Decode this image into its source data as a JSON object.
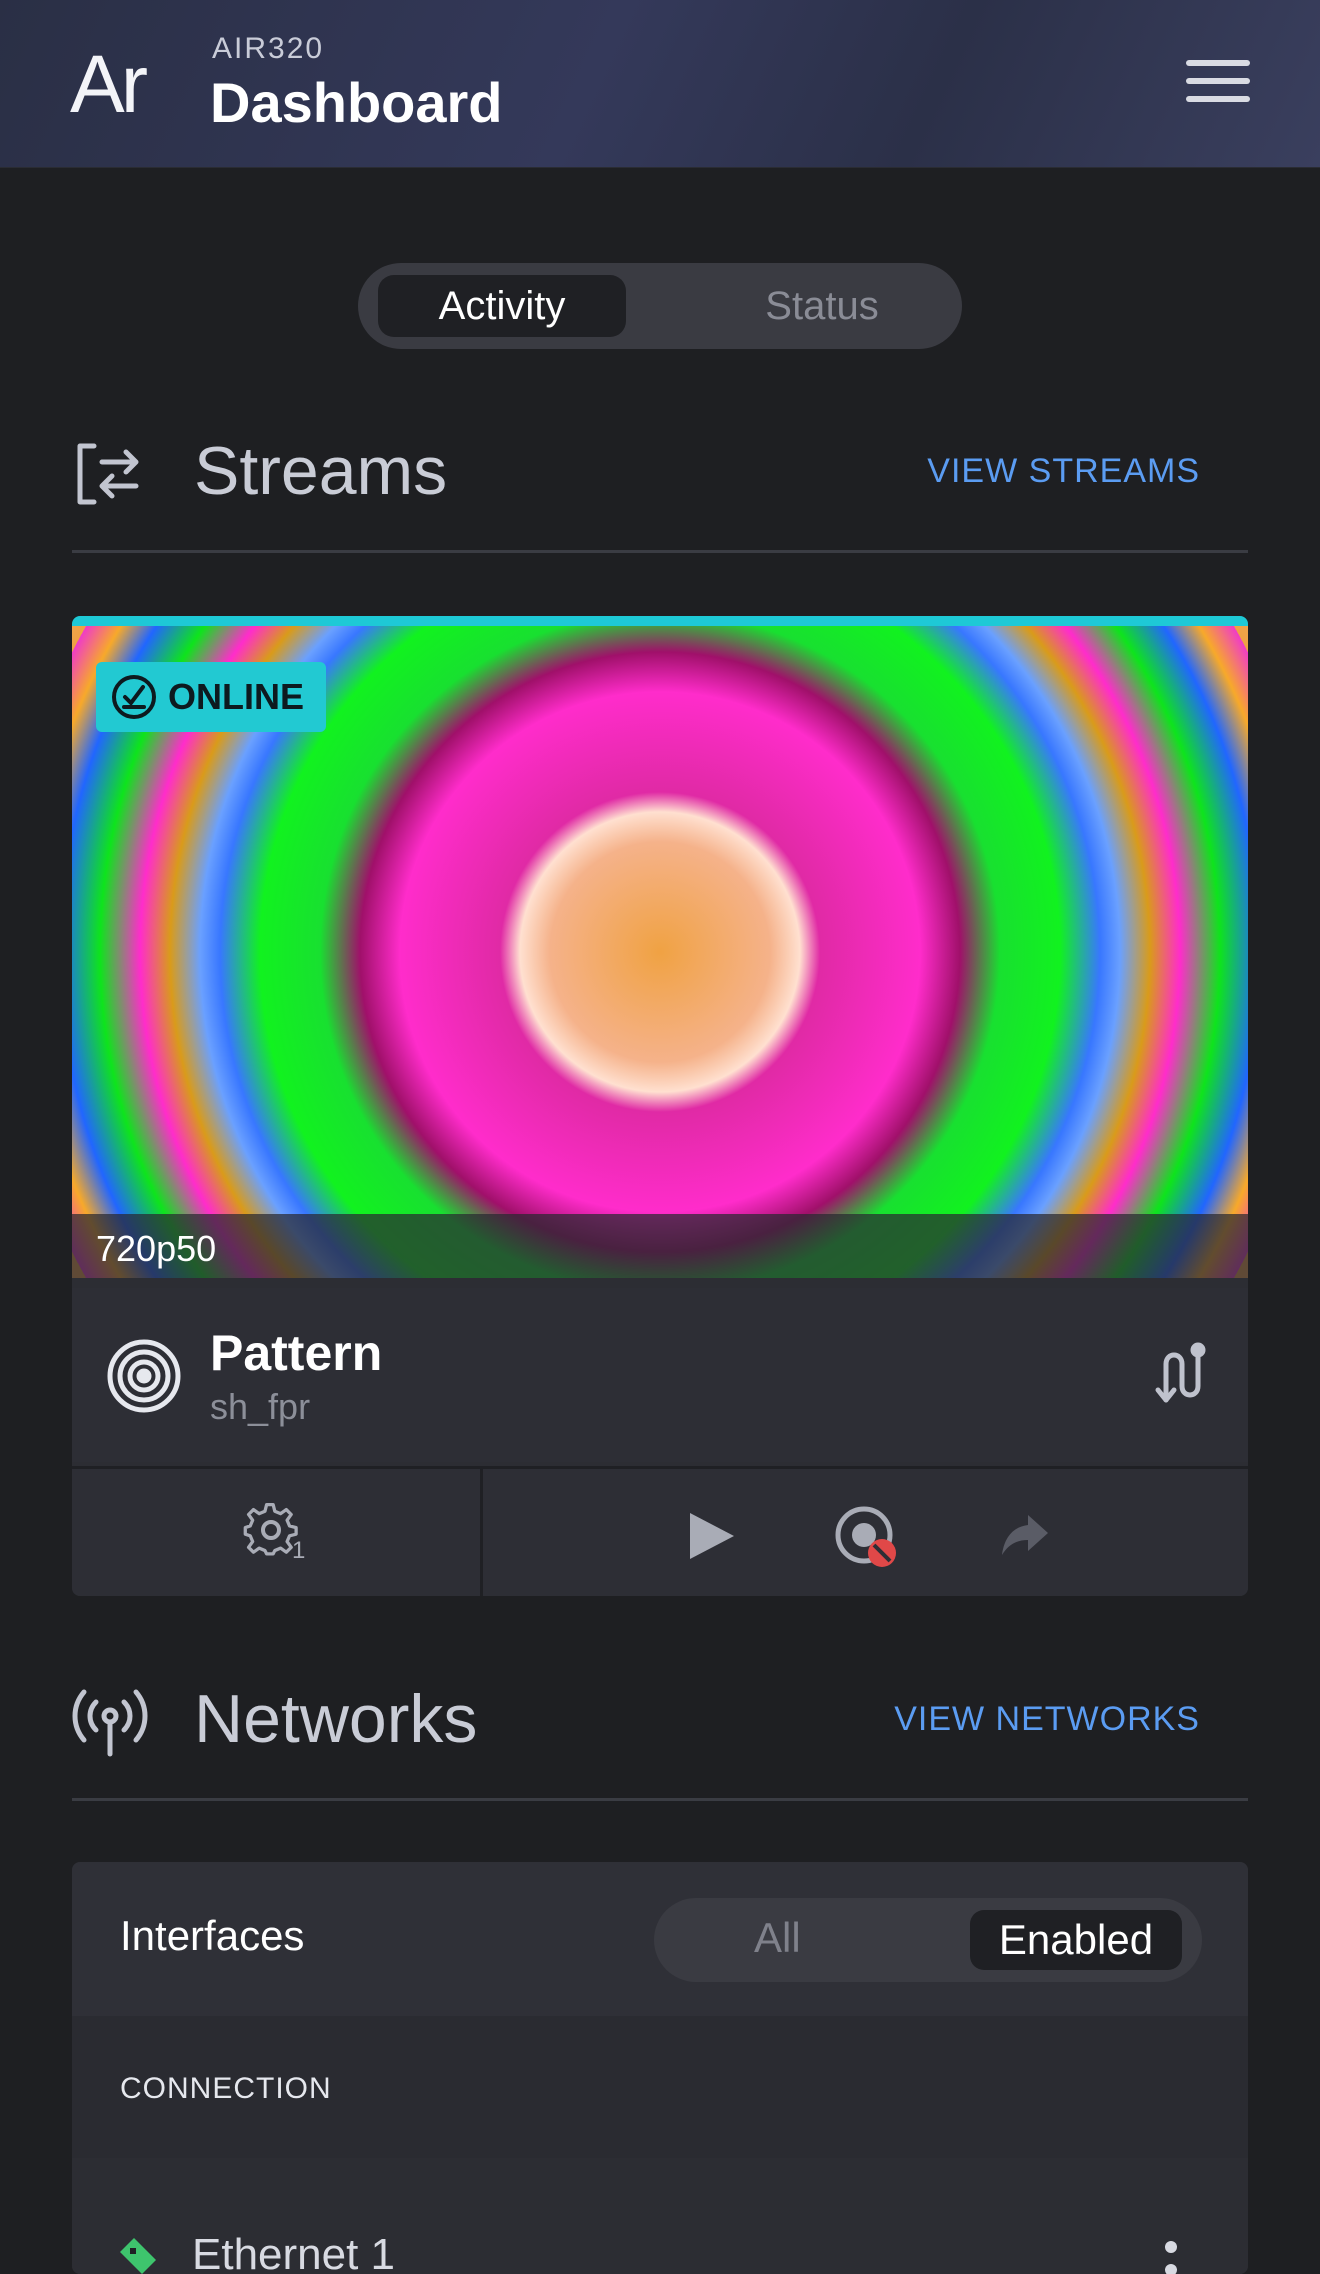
{
  "header": {
    "logo": "Ar",
    "device": "AIR320",
    "title": "Dashboard",
    "menu_icon": "hamburger-menu-icon"
  },
  "view_tabs": [
    {
      "label": "Activity",
      "active": true
    },
    {
      "label": "Status",
      "active": false
    }
  ],
  "streams": {
    "icon": "streams-transfer-icon",
    "title": "Streams",
    "link": "VIEW STREAMS",
    "card": {
      "status": "ONLINE",
      "resolution": "720p50",
      "name": "Pattern",
      "source": "sh_fpr",
      "settings_count": "1",
      "accent_color": "#1ec9d6",
      "actions": [
        "settings-icon",
        "play-icon",
        "record-disabled-icon",
        "share-icon"
      ]
    }
  },
  "networks": {
    "icon": "antenna-icon",
    "title": "Networks",
    "link": "VIEW NETWORKS",
    "interfaces_label": "Interfaces",
    "filter_tabs": [
      {
        "label": "All",
        "active": false
      },
      {
        "label": "Enabled",
        "active": true
      }
    ],
    "connection_header": "CONNECTION",
    "rows": [
      {
        "name": "Ethernet 1",
        "status_color": "#3ec46d"
      }
    ]
  },
  "colors": {
    "link": "#5b9cf2",
    "background": "#1e1f22",
    "badge": "#22c9d2"
  }
}
